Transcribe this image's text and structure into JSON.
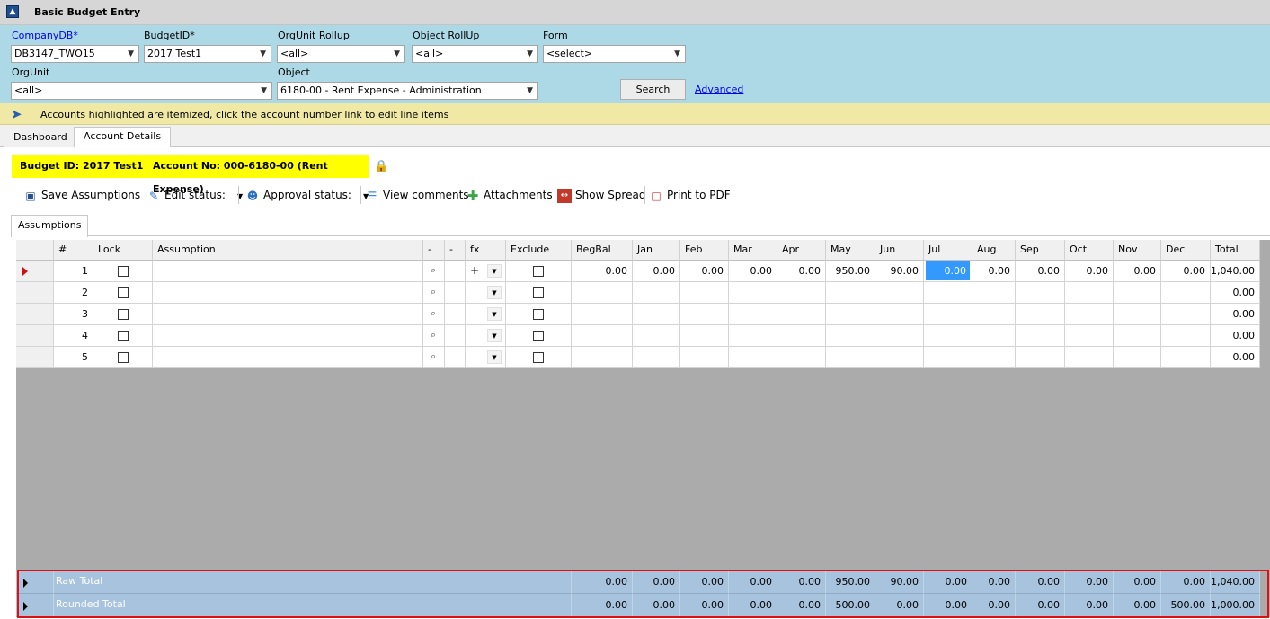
{
  "window": {
    "title": "Basic Budget Entry"
  },
  "filters": {
    "company_db": {
      "label": "CompanyDB*",
      "value": "DB3147_TWO15"
    },
    "budget_id": {
      "label": "BudgetID*",
      "value": "2017 Test1"
    },
    "orgunit_rollup": {
      "label": "OrgUnit Rollup",
      "value": "<all>"
    },
    "object_rollup": {
      "label": "Object RollUp",
      "value": "<all>"
    },
    "form": {
      "label": "Form",
      "value": "<select>"
    },
    "orgunit": {
      "label": "OrgUnit",
      "value": "<all>"
    },
    "object": {
      "label": "Object",
      "value": "6180-00 - Rent Expense - Administration"
    },
    "search_label": "Search",
    "advanced_label": "Advanced"
  },
  "info": {
    "text": "Accounts highlighted are itemized, click the account number link to edit line items"
  },
  "tabs": [
    {
      "label": "Dashboard"
    },
    {
      "label": "Account Details"
    }
  ],
  "badges": {
    "budget": "Budget ID: 2017 Test1",
    "account": "Account No: 000-6180-00 (Rent Expense)"
  },
  "toolbar": {
    "save": "Save Assumptions",
    "edit_status": "Edit status:",
    "approval_status": "Approval status:",
    "view_comments": "View comments",
    "attachments": "Attachments",
    "show_spread": "Show Spread",
    "print_pdf": "Print to PDF"
  },
  "subtab": "Assumptions",
  "grid": {
    "headers": [
      "#",
      "Lock",
      "Assumption",
      "-",
      "-",
      "fx",
      "Exclude",
      "BegBal",
      "Jan",
      "Feb",
      "Mar",
      "Apr",
      "May",
      "Jun",
      "Jul",
      "Aug",
      "Sep",
      "Oct",
      "Nov",
      "Dec",
      "Total"
    ],
    "rows": [
      {
        "num": "1",
        "fx": "+",
        "months": [
          "0.00",
          "0.00",
          "0.00",
          "0.00",
          "0.00",
          "950.00",
          "90.00",
          "0.00",
          "0.00",
          "0.00",
          "0.00",
          "0.00",
          "0.00"
        ],
        "total": "1,040.00"
      },
      {
        "num": "2",
        "fx": "",
        "months": [
          "",
          "",
          "",
          "",
          "",
          "",
          "",
          "",
          "",
          "",
          "",
          "",
          ""
        ],
        "total": "0.00"
      },
      {
        "num": "3",
        "fx": "",
        "months": [
          "",
          "",
          "",
          "",
          "",
          "",
          "",
          "",
          "",
          "",
          "",
          "",
          ""
        ],
        "total": "0.00"
      },
      {
        "num": "4",
        "fx": "",
        "months": [
          "",
          "",
          "",
          "",
          "",
          "",
          "",
          "",
          "",
          "",
          "",
          "",
          ""
        ],
        "total": "0.00"
      },
      {
        "num": "5",
        "fx": "",
        "months": [
          "",
          "",
          "",
          "",
          "",
          "",
          "",
          "",
          "",
          "",
          "",
          "",
          ""
        ],
        "total": "0.00"
      }
    ],
    "totals": [
      {
        "label": "Raw Total",
        "values": [
          "0.00",
          "0.00",
          "0.00",
          "0.00",
          "0.00",
          "950.00",
          "90.00",
          "0.00",
          "0.00",
          "0.00",
          "0.00",
          "0.00",
          "0.00"
        ],
        "total": "1,040.00"
      },
      {
        "label": "Rounded Total",
        "values": [
          "0.00",
          "0.00",
          "0.00",
          "0.00",
          "0.00",
          "500.00",
          "0.00",
          "0.00",
          "0.00",
          "0.00",
          "0.00",
          "0.00",
          "500.00"
        ],
        "total": "1,000.00"
      }
    ]
  },
  "colors": {
    "filter_bg": "#add8e6",
    "info_bg": "#f0e9a6",
    "badge_bg": "#ffff00",
    "selected_cell": "#3399ff",
    "total_rows_bg": "#a7c3de",
    "highlight_border": "#e01010"
  }
}
